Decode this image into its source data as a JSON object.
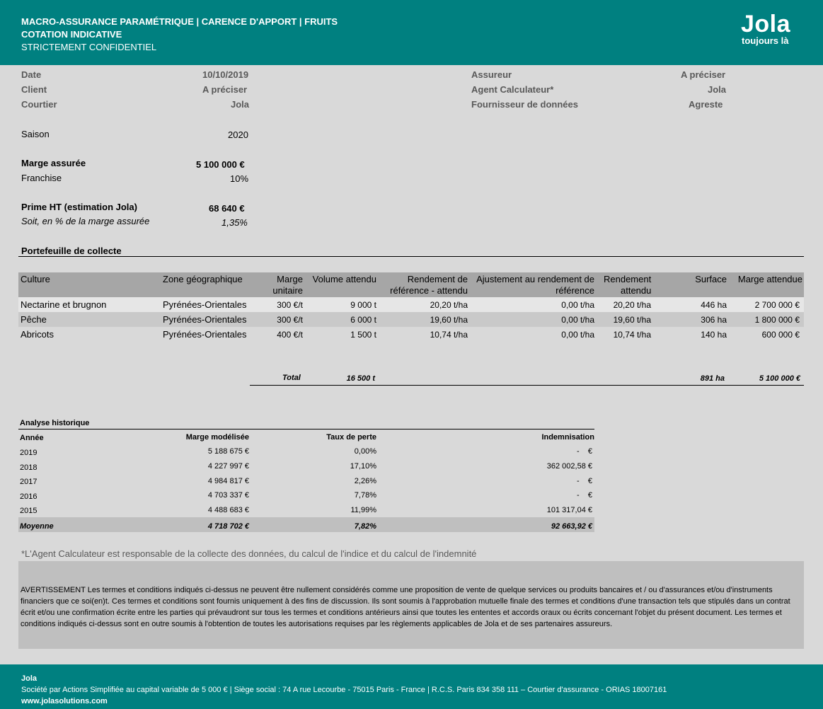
{
  "header": {
    "title_line1": "MACRO-ASSURANCE PARAMÉTRIQUE | CARENCE D'APPORT | FRUITS",
    "title_line2": "COTATION INDICATIVE",
    "title_line3": "STRICTEMENT CONFIDENTIEL",
    "logo_text": "Jola",
    "logo_tagline": "toujours là",
    "bg_color": "#008080"
  },
  "info_left": [
    {
      "label": "Date",
      "value": "10/10/2019"
    },
    {
      "label": "Client",
      "value": "A préciser"
    },
    {
      "label": "Courtier",
      "value": "Jola"
    }
  ],
  "info_right": [
    {
      "label": "Assureur",
      "value": "A préciser"
    },
    {
      "label": "Agent Calculateur*",
      "value": "Jola"
    },
    {
      "label": "Fournisseur de données",
      "value": "Agreste"
    }
  ],
  "saison": {
    "label": "Saison",
    "value": "2020"
  },
  "marge": {
    "label": "Marge assurée",
    "value": "5 100 000 €"
  },
  "franchise": {
    "label": "Franchise",
    "value": "10%"
  },
  "prime": {
    "label": "Prime HT (estimation Jola)",
    "value": "68 640 €"
  },
  "prime_pct": {
    "label": "Soit, en % de la marge assurée",
    "value": "1,35%"
  },
  "portfolio": {
    "title": "Portefeuille de collecte",
    "headers": {
      "culture": "Culture",
      "zone": "Zone géographique",
      "marge_l1": "Marge",
      "marge_l2": "unitaire",
      "volume": "Volume attendu",
      "rend_ref_l1": "Rendement de",
      "rend_ref_l2": "référence - attendu",
      "ajust_l1": "Ajustement au rendement de",
      "ajust_l2": "référence",
      "rend_att_l1": "Rendement",
      "rend_att_l2": "attendu",
      "surface": "Surface",
      "marge_att": "Marge attendue"
    },
    "rows": [
      {
        "culture": "Nectarine et brugnon",
        "zone": "Pyrénées-Orientales",
        "marge": "300 €/t",
        "volume": "9 000 t",
        "rend_ref": "20,20 t/ha",
        "ajust": "0,00 t/ha",
        "rend_att": "20,20 t/ha",
        "surface": "446 ha",
        "marge_att": "2 700 000 €"
      },
      {
        "culture": "Pêche",
        "zone": "Pyrénées-Orientales",
        "marge": "300 €/t",
        "volume": "6 000 t",
        "rend_ref": "19,60 t/ha",
        "ajust": "0,00 t/ha",
        "rend_att": "19,60 t/ha",
        "surface": "306 ha",
        "marge_att": "1 800 000 €"
      },
      {
        "culture": "Abricots",
        "zone": "Pyrénées-Orientales",
        "marge": "400 €/t",
        "volume": "1 500 t",
        "rend_ref": "10,74 t/ha",
        "ajust": "0,00 t/ha",
        "rend_att": "10,74 t/ha",
        "surface": "140 ha",
        "marge_att": "600 000 €"
      }
    ],
    "total": {
      "label": "Total",
      "volume": "16 500 t",
      "surface": "891 ha",
      "marge_att": "5 100 000 €"
    }
  },
  "history": {
    "title": "Analyse historique",
    "headers": {
      "annee": "Année",
      "marge": "Marge modélisée",
      "taux": "Taux de perte",
      "indem": "Indemnisation"
    },
    "rows": [
      {
        "annee": "2019",
        "marge": "5 188 675 €",
        "taux": "0,00%",
        "indem": "-    €"
      },
      {
        "annee": "2018",
        "marge": "4 227 997 €",
        "taux": "17,10%",
        "indem": "362 002,58 €"
      },
      {
        "annee": "2017",
        "marge": "4 984 817 €",
        "taux": "2,26%",
        "indem": "-    €"
      },
      {
        "annee": "2016",
        "marge": "4 703 337 €",
        "taux": "7,78%",
        "indem": "-    €"
      },
      {
        "annee": "2015",
        "marge": "4 488 683 €",
        "taux": "11,99%",
        "indem": "101 317,04 €"
      }
    ],
    "average": {
      "annee": "Moyenne",
      "marge": "4 718 702 €",
      "taux": "7,82%",
      "indem": "92 663,92 €"
    }
  },
  "note": "*L'Agent Calculateur est responsable de la collecte des données, du calcul de l'indice et du calcul de l'indemnité",
  "disclaimer": "AVERTISSEMENT Les termes et conditions indiqués ci-dessus ne peuvent être nullement considérés comme une proposition de vente de quelque services ou produits bancaires et / ou d'assurances et/ou d'instruments financiers que ce soi(en)t. Ces termes et conditions sont fournis uniquement à des fins de discussion. Ils sont soumis à l'approbation mutuelle finale des termes et conditions d'une transaction tels que stipulés dans un contrat écrit et/ou une confirmation écrite entre les parties qui prévaudront sur tous les termes et conditions antérieurs ainsi que toutes les ententes et accords oraux ou écrits concernant l'objet du présent document. Les termes et conditions indiqués ci-dessus sont en outre soumis à l'obtention de toutes les autorisations requises par les règlements applicables de Jola et de ses partenaires assureurs.",
  "footer": {
    "company": "Jola",
    "legal": "Société par Actions Simplifiée au capital variable de 5 000 € | Siège social : 74 A rue Lecourbe - 75015 Paris - France | R.C.S. Paris 834 358 111 – Courtier d'assurance - ORIAS 18007161",
    "website": "www.jolasolutions.com"
  }
}
